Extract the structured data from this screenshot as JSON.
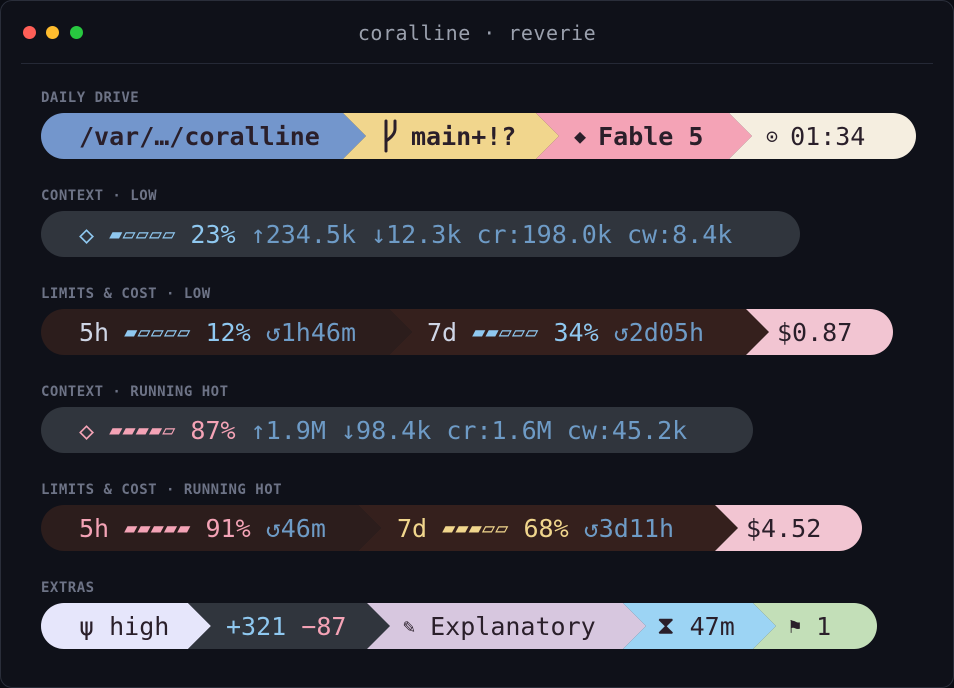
{
  "window": {
    "title": "coralline · reverie"
  },
  "sections": {
    "daily": {
      "label": "DAILY DRIVE",
      "path": "/var/…/coralline",
      "branch_icon": "git-branch-icon",
      "branch": "main+!?",
      "model_icon": "diamond-icon",
      "model": "Fable 5",
      "clock_icon": "clock-icon",
      "time": "01:34",
      "colors": {
        "path": "#7396cc",
        "branch": "#f1d68d",
        "model": "#f4a3b6",
        "time": "#f5eee0",
        "text": "#2a1f2a"
      }
    },
    "context_low": {
      "label": "CONTEXT · LOW",
      "icon": "◇",
      "meter": "▰▱▱▱▱",
      "pct": "23%",
      "in": "↑234.5k",
      "out": "↓12.3k",
      "cr": "cr:198.0k",
      "cw": "cw:8.4k",
      "colors": {
        "bg": "#30353d",
        "accent": "#8fc8f0",
        "dim": "#6e9bc6"
      }
    },
    "limits_low": {
      "label": "LIMITS & COST · LOW",
      "w5_label": "5h",
      "w5_meter": "▰▱▱▱▱",
      "w5_pct": "12%",
      "w5_reset": "↺1h46m",
      "w7_label": "7d",
      "w7_meter": "▰▰▱▱▱",
      "w7_pct": "34%",
      "w7_reset": "↺2d05h",
      "cost": "$0.87",
      "colors": {
        "bg5": "#2c1d1c",
        "bg7": "#35201d",
        "cost_bg": "#f2c5d2",
        "accent": "#8fc8f0"
      }
    },
    "context_hot": {
      "label": "CONTEXT · RUNNING HOT",
      "icon": "◇",
      "meter": "▰▰▰▰▱",
      "pct": "87%",
      "in": "↑1.9M",
      "out": "↓98.4k",
      "cr": "cr:1.6M",
      "cw": "cw:45.2k",
      "colors": {
        "accent": "#f4a3b6"
      }
    },
    "limits_hot": {
      "label": "LIMITS & COST · RUNNING HOT",
      "w5_label": "5h",
      "w5_meter": "▰▰▰▰▰",
      "w5_pct": "91%",
      "w5_reset": "↺46m",
      "w7_label": "7d",
      "w7_meter": "▰▰▰▱▱",
      "w7_pct": "68%",
      "w7_reset": "↺3d11h",
      "cost": "$4.52",
      "colors": {
        "hot": "#f4a3b6",
        "warm": "#f1d68d"
      }
    },
    "extras": {
      "label": "EXTRAS",
      "effort_icon": "ψ",
      "effort": "high",
      "added": "+321",
      "removed": "−87",
      "style_icon": "✎",
      "style": "Explanatory",
      "timer_icon": "⧗",
      "timer": "47m",
      "flag_icon": "⚑",
      "flags": "1",
      "colors": {
        "effort": "#e6e6fb",
        "diff": "#30353d",
        "style": "#d7c7df",
        "timer": "#9cd4f4",
        "flag": "#c3dfb8"
      }
    }
  }
}
